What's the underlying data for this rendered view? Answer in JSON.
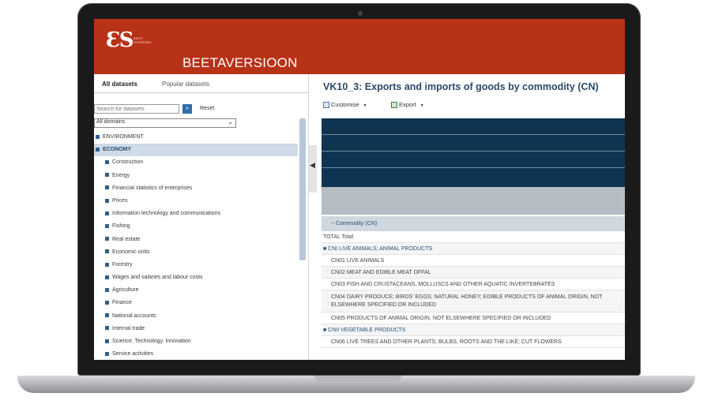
{
  "header": {
    "logo_mark": "ƐS",
    "logo_sub": "EESTI STATISTIKA",
    "title": "BEETAVERSIOON"
  },
  "left": {
    "tabs": [
      "All datasets",
      "Popular datasets"
    ],
    "search_placeholder": "Search for datasets",
    "search_button": "»",
    "reset_label": "Reset",
    "domain_select": "All domains",
    "tree": [
      {
        "label": "ENVIRONMENT",
        "level": "top",
        "selected": false
      },
      {
        "label": "ECONOMY",
        "level": "top",
        "selected": true
      },
      {
        "label": "Construction",
        "level": "sub"
      },
      {
        "label": "Energy",
        "level": "sub"
      },
      {
        "label": "Financial statistics of enterprises",
        "level": "sub"
      },
      {
        "label": "Prices",
        "level": "sub"
      },
      {
        "label": "Information technology and communications",
        "level": "sub"
      },
      {
        "label": "Fishing",
        "level": "sub"
      },
      {
        "label": "Real estate",
        "level": "sub"
      },
      {
        "label": "Economic units",
        "level": "sub"
      },
      {
        "label": "Forestry",
        "level": "sub"
      },
      {
        "label": "Wages and salaries and labour costs",
        "level": "sub"
      },
      {
        "label": "Agriculture",
        "level": "sub"
      },
      {
        "label": "Finance",
        "level": "sub"
      },
      {
        "label": "National accounts",
        "level": "sub"
      },
      {
        "label": "Internal trade",
        "level": "sub"
      },
      {
        "label": "Science. Technology. Innovation",
        "level": "sub"
      },
      {
        "label": "Service activities",
        "level": "sub"
      }
    ]
  },
  "collapse_arrow": "◀",
  "right": {
    "title": "VK10_3: Exports and imports of goods by commodity (CN)",
    "toolbar": {
      "customise": "Customise",
      "export": "Export",
      "caret": "▼"
    },
    "grid_header": "− Commodity (CN)",
    "rows": [
      {
        "text": "TOTAL Total",
        "cls": ""
      },
      {
        "text": "■ CNI LIVE ANIMALS; ANIMAL PRODUCTS",
        "cls": "group alt"
      },
      {
        "text": "CN01 LIVE ANIMALS",
        "cls": "lvl2"
      },
      {
        "text": "CN02 MEAT AND EDIBLE MEAT OFFAL",
        "cls": "lvl2 alt"
      },
      {
        "text": "CN03 FISH AND CRUSTACEANS, MOLLUSCS AND OTHER AQUATIC INVERTEBRATES",
        "cls": "lvl2"
      },
      {
        "text": "CN04 DAIRY PRODUCE; BIRDS' EGGS; NATURAL HONEY; EDIBLE PRODUCTS OF ANIMAL ORIGIN, NOT ELSEWHERE SPECIFIED OR INCLUDED",
        "cls": "lvl2 alt wrap"
      },
      {
        "text": "CN05 PRODUCTS OF ANIMAL ORIGIN, NOT ELSEWHERE SPECIFIED OR INCLUDED",
        "cls": "lvl2"
      },
      {
        "text": "■ CNII VEGETABLE PRODUCTS",
        "cls": "group alt"
      },
      {
        "text": "CN06 LIVE TREES AND OTHER PLANTS; BULBS, ROOTS AND THE LIKE; CUT FLOWERS",
        "cls": "lvl2"
      }
    ]
  }
}
